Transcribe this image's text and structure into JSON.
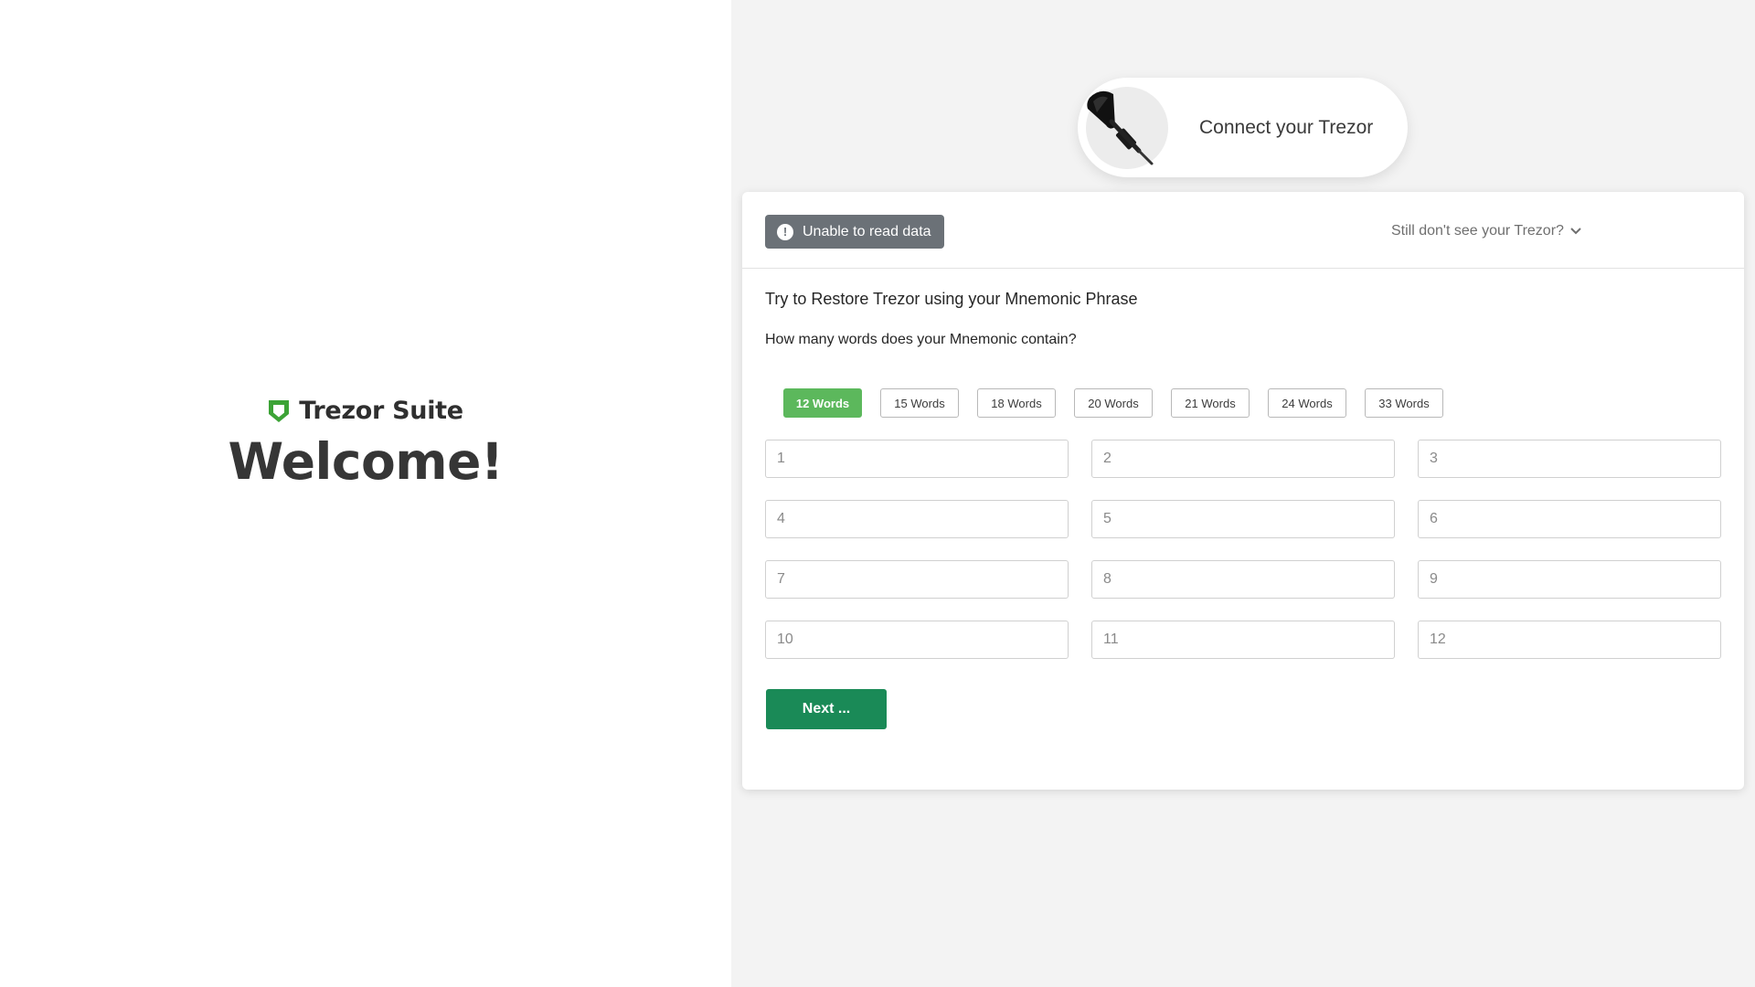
{
  "brand": {
    "name": "Trezor Suite",
    "logo_color": "#3ca336",
    "welcome": "Welcome!"
  },
  "connect": {
    "text": "Connect your Trezor",
    "icon": "usb-cable-icon"
  },
  "card": {
    "error_badge": "Unable to read data",
    "error_icon": "exclamation-circle-icon",
    "help_link": "Still don't see your Trezor?",
    "restore_title": "Try to Restore Trezor using your Mnemonic Phrase",
    "question": "How many words does your Mnemonic contain?",
    "word_options": [
      "12 Words",
      "15 Words",
      "18 Words",
      "20 Words",
      "21 Words",
      "24 Words",
      "33 Words"
    ],
    "selected_option": "12 Words",
    "inputs": [
      {
        "value": "",
        "placeholder": "1"
      },
      {
        "value": "",
        "placeholder": "2"
      },
      {
        "value": "",
        "placeholder": "3"
      },
      {
        "value": "",
        "placeholder": "4"
      },
      {
        "value": "",
        "placeholder": "5"
      },
      {
        "value": "",
        "placeholder": "6"
      },
      {
        "value": "",
        "placeholder": "7"
      },
      {
        "value": "",
        "placeholder": "8"
      },
      {
        "value": "",
        "placeholder": "9"
      },
      {
        "value": "",
        "placeholder": "10"
      },
      {
        "value": "",
        "placeholder": "11"
      },
      {
        "value": "",
        "placeholder": "12"
      }
    ],
    "next_label": "Next ..."
  },
  "colors": {
    "active_option": "#5cb85c",
    "next_button": "#1a8a57",
    "badge": "#6b7177"
  }
}
